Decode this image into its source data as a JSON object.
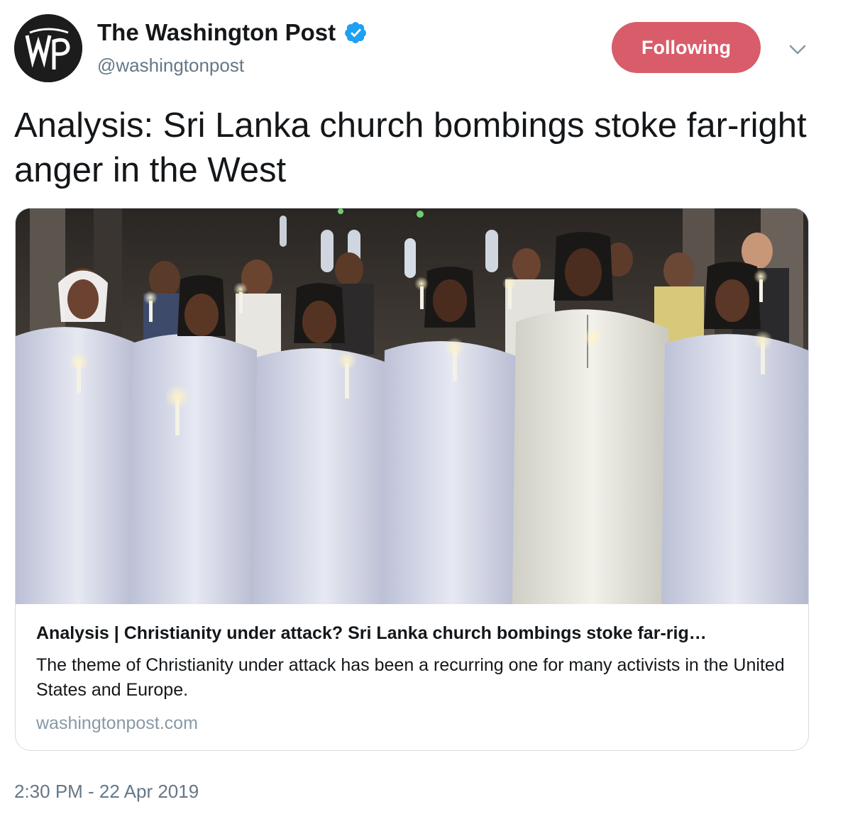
{
  "author": {
    "display_name": "The Washington Post",
    "handle": "@washingtonpost",
    "avatar_text": "wp",
    "verified_icon": "verified-badge-icon"
  },
  "actions": {
    "follow_label": "Following",
    "menu_icon": "chevron-down-icon"
  },
  "tweet": {
    "text": "Analysis: Sri Lanka church bombings stoke far-right anger in the West",
    "timestamp": "2:30 PM - 22 Apr 2019"
  },
  "card": {
    "image_icon": "article-photo-image",
    "title": "Analysis | Christianity under attack? Sri Lanka church bombings stoke far-rig…",
    "description": "The theme of Christianity under attack has been a recurring one for many activists in the United States and Europe.",
    "domain": "washingtonpost.com"
  },
  "colors": {
    "follow_button": "#d85c6a",
    "verified": "#1da1f2",
    "secondary_text": "#657786",
    "card_border": "#d4dbe1"
  }
}
